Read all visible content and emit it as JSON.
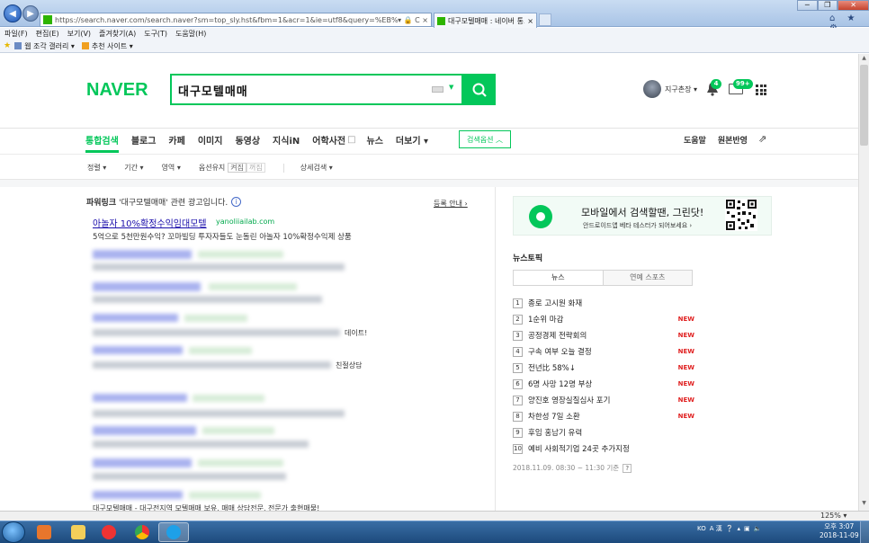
{
  "browser": {
    "address": "https://search.naver.com/search.naver?sm=top_sly.hst&fbm=1&acr=1&ie=utf8&query=%EB%8C%80%EA%B5%AC%EB%AA%A8",
    "tab_label": "대구모텔매매 : 네이버 통...",
    "tab_close": "×",
    "window_controls": [
      "─",
      "❐",
      "✕"
    ],
    "tools": "⌂ ★ ⚙",
    "address_tools": "▾ 🔒 C ×",
    "menu": [
      "파일(F)",
      "편집(E)",
      "보기(V)",
      "즐겨찾기(A)",
      "도구(T)",
      "도움말(H)"
    ],
    "favorites": [
      "웹 조각 갤러리 ▾",
      "추천 사이트 ▾"
    ],
    "zoom": "125% ▾"
  },
  "header": {
    "logo": "NAVER",
    "search_value": "대구모텔매매",
    "user_name": "지구촌장 ▾",
    "bell_count": "4",
    "mail_count": "99+"
  },
  "tabs": {
    "main": [
      "통합검색",
      "블로그",
      "카페",
      "이미지",
      "동영상",
      "지식iN",
      "어학사전",
      "뉴스",
      "더보기 ▾"
    ],
    "search_option": "검색옵션 ︿",
    "right": [
      "도움말",
      "원본반영"
    ]
  },
  "subtabs": {
    "items": [
      "정렬 ▾",
      "기간 ▾",
      "영역 ▾"
    ],
    "option_label": "옵션유지",
    "option_on": "켜짐",
    "option_off": "꺼짐",
    "detail": "상세검색 ▾"
  },
  "powerlink": {
    "title_bold": "파워링크",
    "title_rest": "'대구모텔매매' 관련 광고입니다.",
    "info": "i",
    "guide": "등록 안내 ›",
    "ad1": {
      "title": "아놀자 10%확정수익임대모텔",
      "url": "yanoliiailab.com",
      "desc": "5억으로 5천만원수익? 꼬마빌딩 투자자들도 눈돌린 아놀자 10%확정수익제 상품"
    },
    "fragment1": "데이트!",
    "fragment2": "친절상담",
    "bottom": "대구모텔매매 - 대구전지역 모텔매매 보유, 매매 상담전문, 전문가 출현매물!"
  },
  "promo": {
    "title": "모바일에서 검색할땐, 그린닷!",
    "subtitle": "안드로이드앱 베타 테스터가 되어보세요 ›"
  },
  "news": {
    "title": "뉴스토픽",
    "tabs": [
      "뉴스",
      "연예 스포츠"
    ],
    "items": [
      {
        "num": "1",
        "text": "종로 고시원 화재",
        "badge": ""
      },
      {
        "num": "2",
        "text": "1순위 마감",
        "badge": "NEW"
      },
      {
        "num": "3",
        "text": "공정경제 전략회의",
        "badge": "NEW"
      },
      {
        "num": "4",
        "text": "구속 여부 오늘 결정",
        "badge": "NEW"
      },
      {
        "num": "5",
        "text": "전년比 58%↓",
        "badge": "NEW"
      },
      {
        "num": "6",
        "text": "6명 사망 12명 부상",
        "badge": "NEW"
      },
      {
        "num": "7",
        "text": "양진호 영장실질심사 포기",
        "badge": "NEW"
      },
      {
        "num": "8",
        "text": "차한성 7일 소환",
        "badge": "NEW"
      },
      {
        "num": "9",
        "text": "후임 홍남기 유력",
        "badge": ""
      },
      {
        "num": "10",
        "text": "예비 사회적기업 24곳 추가지정",
        "badge": ""
      }
    ],
    "time": "2018.11.09. 08:30 ~ 11:30 기준",
    "help": "?"
  },
  "taskbar": {
    "tray_lang": "KO",
    "tray_ime": "A 漢",
    "time": "오후 3:07",
    "date": "2018-11-09"
  },
  "colors": {
    "naver_green": "#03c75a",
    "ad_title": "#1a0dab",
    "new_badge": "#e02020"
  }
}
